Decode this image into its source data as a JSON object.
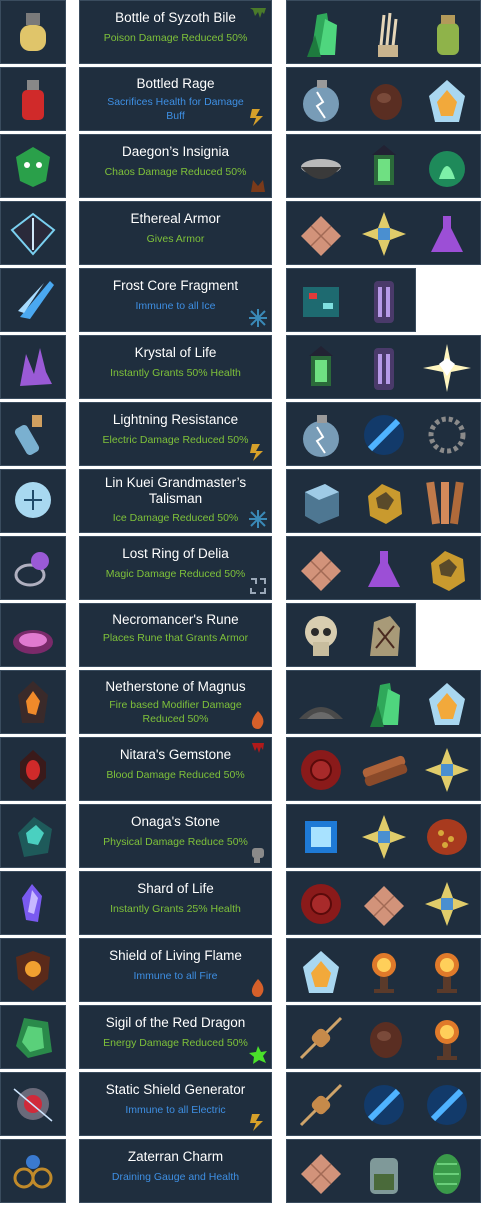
{
  "rows": [
    {
      "name": "Bottle of Syzoth Bile",
      "desc": "Poison Damage Reduced 50%",
      "desc_color": "green",
      "badge": "poison-drip-icon",
      "items": [
        "green-crystal-icon",
        "skeletal-hand-icon",
        "green-jar-icon"
      ]
    },
    {
      "name": "Bottled Rage",
      "desc": "Sacrifices Health for Damage Buff",
      "desc_color": "blue",
      "badge": "lightning-icon",
      "items": [
        "lightning-orb-icon",
        "leather-pouch-icon",
        "fire-ice-crystal-icon"
      ]
    },
    {
      "name": "Daegon’s Insignia",
      "desc": "Chaos Damage Reduced 50%",
      "desc_color": "green",
      "badge": "chaos-horns-icon",
      "items": [
        "ash-bowl-icon",
        "green-lantern-icon",
        "green-flame-orb-icon"
      ]
    },
    {
      "name": "Ethereal Armor",
      "desc": "Gives Armor",
      "desc_color": "green",
      "badge": "",
      "items": [
        "copper-plates-icon",
        "star-talisman-icon",
        "purple-potion-icon"
      ]
    },
    {
      "name": "Frost Core Fragment",
      "desc": "Immune to all Ice",
      "desc_color": "blue",
      "badge": "snowflake-icon",
      "items": [
        "circuit-box-icon",
        "purple-canister-icon"
      ]
    },
    {
      "name": "Krystal of Life",
      "desc": "Instantly Grants 50% Health",
      "desc_color": "green",
      "badge": "",
      "items": [
        "green-lantern-icon",
        "purple-canister-icon",
        "diamond-burst-icon"
      ]
    },
    {
      "name": "Lightning Resistance",
      "desc": "Electric Damage Reduced 50%",
      "desc_color": "green",
      "badge": "lightning-icon",
      "items": [
        "lightning-orb-icon",
        "electric-syringe-icon",
        "chain-coil-icon"
      ]
    },
    {
      "name": "Lin Kuei Grandmaster’s Talisman",
      "desc": "Ice Damage Reduced 50%",
      "desc_color": "green",
      "badge": "snowflake-icon",
      "items": [
        "ice-cube-icon",
        "gold-ore-icon",
        "copper-strips-icon"
      ]
    },
    {
      "name": "Lost Ring of Delia",
      "desc": "Magic Damage Reduced 50%",
      "desc_color": "green",
      "badge": "magic-rune-icon",
      "items": [
        "copper-plates-icon",
        "purple-potion-icon",
        "gold-ore-icon"
      ]
    },
    {
      "name": "Necromancer's Rune",
      "desc": "Places Rune that Grants Armor",
      "desc_color": "green",
      "badge": "",
      "items": [
        "skull-icon",
        "rune-stone-icon"
      ]
    },
    {
      "name": "Netherstone of Magnus",
      "desc": "Fire based Modifier Damage Reduced 50%",
      "desc_color": "green",
      "badge": "flame-icon",
      "items": [
        "ash-pile-icon",
        "green-crystal-icon",
        "fire-ice-crystal-icon"
      ]
    },
    {
      "name": "Nitara's Gemstone",
      "desc": "Blood Damage Reduced 50%",
      "desc_color": "green",
      "badge": "blood-drip-icon",
      "items": [
        "wax-seal-icon",
        "scroll-bundle-icon",
        "star-talisman-icon"
      ]
    },
    {
      "name": "Onaga's Stone",
      "desc": "Physical Damage Reduce 50%",
      "desc_color": "green",
      "badge": "fist-icon",
      "items": [
        "glowing-cube-icon",
        "star-talisman-icon",
        "dragon-scale-icon"
      ]
    },
    {
      "name": "Shard of Life",
      "desc": "Instantly Grants 25% Health",
      "desc_color": "green",
      "badge": "",
      "items": [
        "wax-seal-icon",
        "copper-plates-icon",
        "star-talisman-icon"
      ]
    },
    {
      "name": "Shield of Living Flame",
      "desc": "Immune to all Fire",
      "desc_color": "blue",
      "badge": "flame-icon",
      "items": [
        "fire-ice-crystal-icon",
        "fire-brazier-icon",
        "fire-brazier-icon"
      ]
    },
    {
      "name": "Sigil of the Red Dragon",
      "desc": "Energy Damage Reduced 50%",
      "desc_color": "green",
      "badge": "energy-splat-icon",
      "items": [
        "resistor-icon",
        "leather-pouch-icon",
        "fire-brazier-icon"
      ]
    },
    {
      "name": "Static Shield Generator",
      "desc": "Immune to all Electric",
      "desc_color": "blue",
      "badge": "lightning-icon",
      "items": [
        "resistor-icon",
        "electric-syringe-icon",
        "electric-syringe-icon"
      ]
    },
    {
      "name": "Zaterran Charm",
      "desc": "Draining Gauge and Health",
      "desc_color": "blue",
      "badge": "",
      "items": [
        "copper-plates-icon",
        "herb-jar-icon",
        "green-scale-icon"
      ]
    }
  ],
  "relic_icons": [
    "bile-bottle-icon",
    "rage-bottle-icon",
    "demon-mask-icon",
    "armor-crest-icon",
    "frost-shard-icon",
    "life-crystal-icon",
    "lightning-gauntlet-icon",
    "ice-talisman-icon",
    "ring-icon",
    "necro-rune-icon",
    "netherstone-icon",
    "blood-gem-icon",
    "onaga-stone-icon",
    "life-shard-icon",
    "flame-shield-icon",
    "dragon-sigil-icon",
    "static-generator-icon",
    "zaterran-charm-icon"
  ],
  "colors": {
    "panel": "#1f2e3e",
    "border": "#3a4c5e",
    "green": "#7ec13a",
    "blue": "#3e8fe3",
    "title": "#ffffff"
  }
}
